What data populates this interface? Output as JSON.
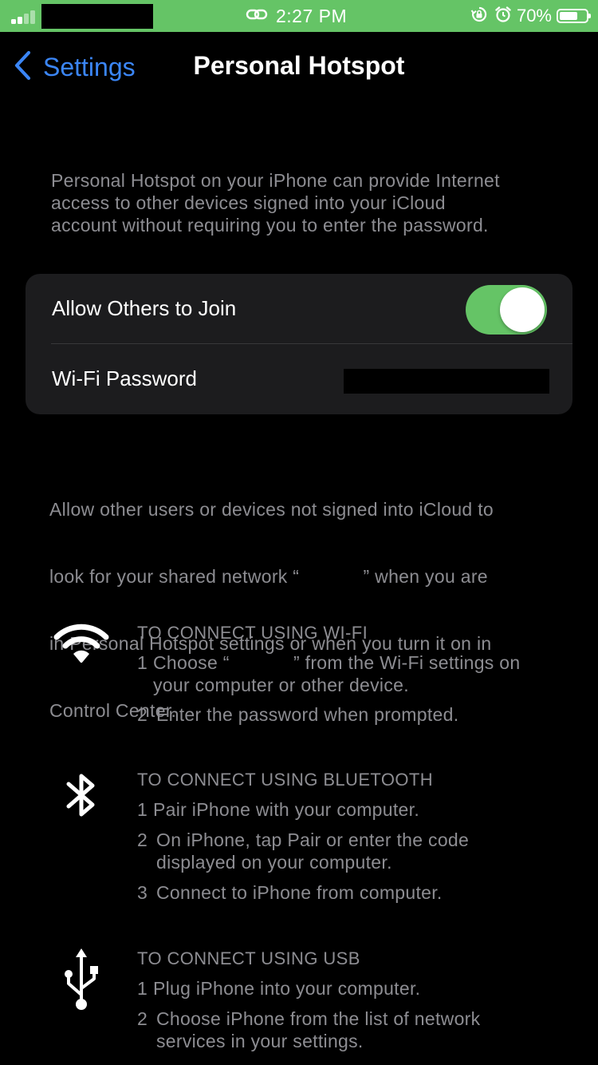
{
  "status_bar": {
    "time": "2:27 PM",
    "battery_percent": "70%",
    "battery_level": 0.7,
    "background_color": "#65c466"
  },
  "nav": {
    "back_label": "Settings",
    "title": "Personal Hotspot"
  },
  "intro_text": [
    "Personal Hotspot on your iPhone can provide Internet",
    "access to other devices signed into your iCloud",
    "account without requiring you to enter the password."
  ],
  "settings": {
    "allow_others_label": "Allow Others to Join",
    "allow_others_on": true,
    "wifi_password_label": "Wi-Fi Password"
  },
  "footer_text": [
    "Allow other users or devices not signed into iCloud to",
    "look for your shared network “            ” when you are",
    "in Personal Hotspot settings or when you turn it on in",
    "Control Center."
  ],
  "connect": {
    "wifi": {
      "icon": "wifi-icon",
      "heading": "TO CONNECT USING WI-FI",
      "steps": [
        {
          "num": "1",
          "lines": [
            "Choose “            ” from the Wi-Fi settings on",
            "your computer or other device."
          ]
        },
        {
          "num": "2",
          "lines": [
            "Enter the password when prompted."
          ]
        }
      ]
    },
    "bluetooth": {
      "icon": "bluetooth-icon",
      "heading": "TO CONNECT USING BLUETOOTH",
      "steps": [
        {
          "num": "1",
          "lines": [
            "Pair iPhone with your computer."
          ]
        },
        {
          "num": "2",
          "lines": [
            "On iPhone, tap Pair or enter the code",
            "displayed on your computer."
          ]
        },
        {
          "num": "3",
          "lines": [
            "Connect to iPhone from computer."
          ]
        }
      ]
    },
    "usb": {
      "icon": "usb-icon",
      "heading": "TO CONNECT USING USB",
      "steps": [
        {
          "num": "1",
          "lines": [
            "Plug iPhone into your computer."
          ]
        },
        {
          "num": "2",
          "lines": [
            "Choose iPhone from the list of network",
            "services in your settings."
          ]
        }
      ]
    }
  },
  "colors": {
    "accent": "#3b86f7",
    "toggle_on": "#65c466",
    "secondary_text": "#8d8d92",
    "card": "#1c1c1e"
  }
}
